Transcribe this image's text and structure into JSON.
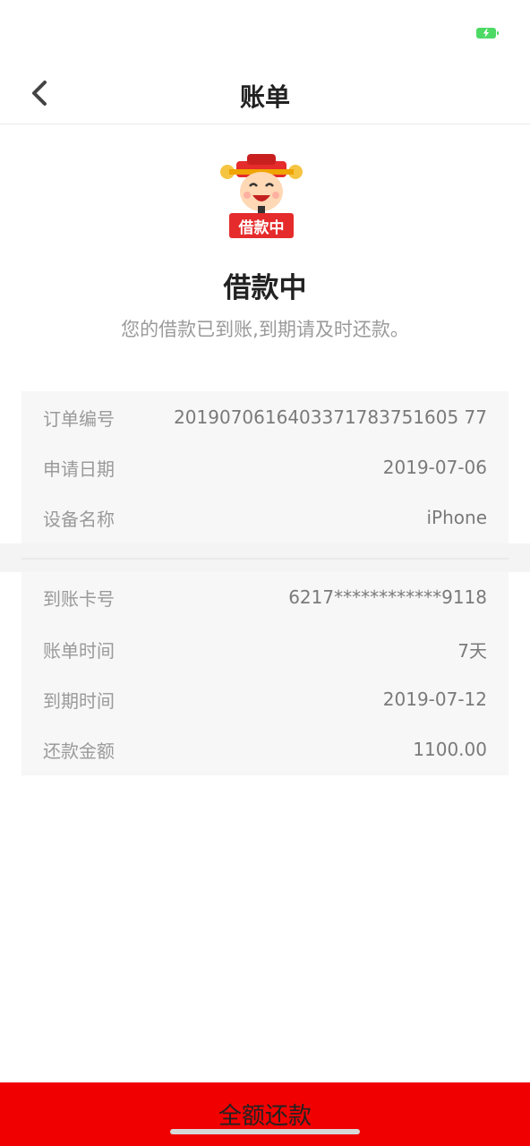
{
  "nav": {
    "title": "账单"
  },
  "status": {
    "badge": "借款中",
    "title": "借款中",
    "description": "您的借款已到账,到期请及时还款。"
  },
  "order_info": [
    {
      "label": "订单编号",
      "value": "2019070616403371783751605 77"
    },
    {
      "label": "申请日期",
      "value": "2019-07-06"
    },
    {
      "label": "设备名称",
      "value": "iPhone"
    }
  ],
  "bill_info": [
    {
      "label": "到账卡号",
      "value": "6217************9118"
    },
    {
      "label": "账单时间",
      "value": "7天"
    },
    {
      "label": "到期时间",
      "value": "2019-07-12"
    },
    {
      "label": "还款金额",
      "value": "1100.00"
    }
  ],
  "footer": {
    "button_label": "全额还款"
  },
  "colors": {
    "primary": "#f00000",
    "badge": "#e52b2b",
    "battery": "#4cd964"
  }
}
